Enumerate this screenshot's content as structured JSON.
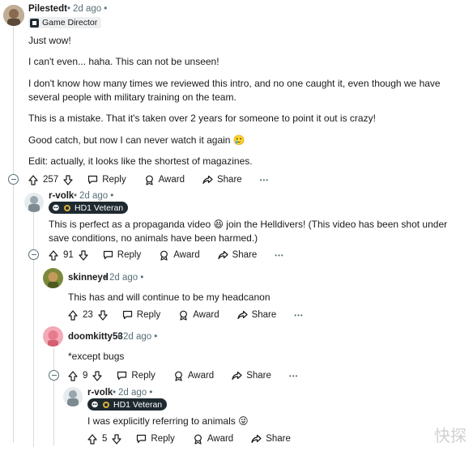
{
  "comments": [
    {
      "author": "Pilestedt",
      "time": "2d ago",
      "flair": "Game Director",
      "paragraphs": [
        "Just wow!",
        "I can't even... haha. This can not be unseen!",
        "I don't know how many times we reviewed this intro, and no one caught it, even though we have several people with military training on the team.",
        "This is a mistake. That it's taken over 2 years for someone to point it out is crazy!",
        "Good catch, but now I can never watch it again 🥲",
        "Edit: actually, it looks like the shortest of magazines."
      ],
      "votes": "257"
    },
    {
      "author": "r-volk",
      "time": "2d ago",
      "flair": "HD1 Veteran",
      "paragraphs": [
        "This is perfect as a propaganda video 😆 join the Helldivers! (This video has been shot under save conditions, no animals have been harmed.)"
      ],
      "votes": "91"
    },
    {
      "author": "skinneyd",
      "time": "2d ago",
      "paragraphs": [
        "This has and will continue to be my headcanon"
      ],
      "votes": "23"
    },
    {
      "author": "doomkitty53",
      "time": "2d ago",
      "paragraphs": [
        "*except bugs"
      ],
      "votes": "9"
    },
    {
      "author": "r-volk",
      "time": "2d ago",
      "flair": "HD1 Veteran",
      "paragraphs": [
        "I was explicitly referring to animals 😜"
      ],
      "votes": "5"
    }
  ],
  "actions": {
    "reply": "Reply",
    "award": "Award",
    "share": "Share",
    "more": "•••"
  },
  "meta_dot": "•",
  "watermark": "快探",
  "colors": {
    "text": "#1a1a1b",
    "meta": "#576f76",
    "thread_line": "#d8dadc",
    "flair_dark": "#1f2a30"
  }
}
